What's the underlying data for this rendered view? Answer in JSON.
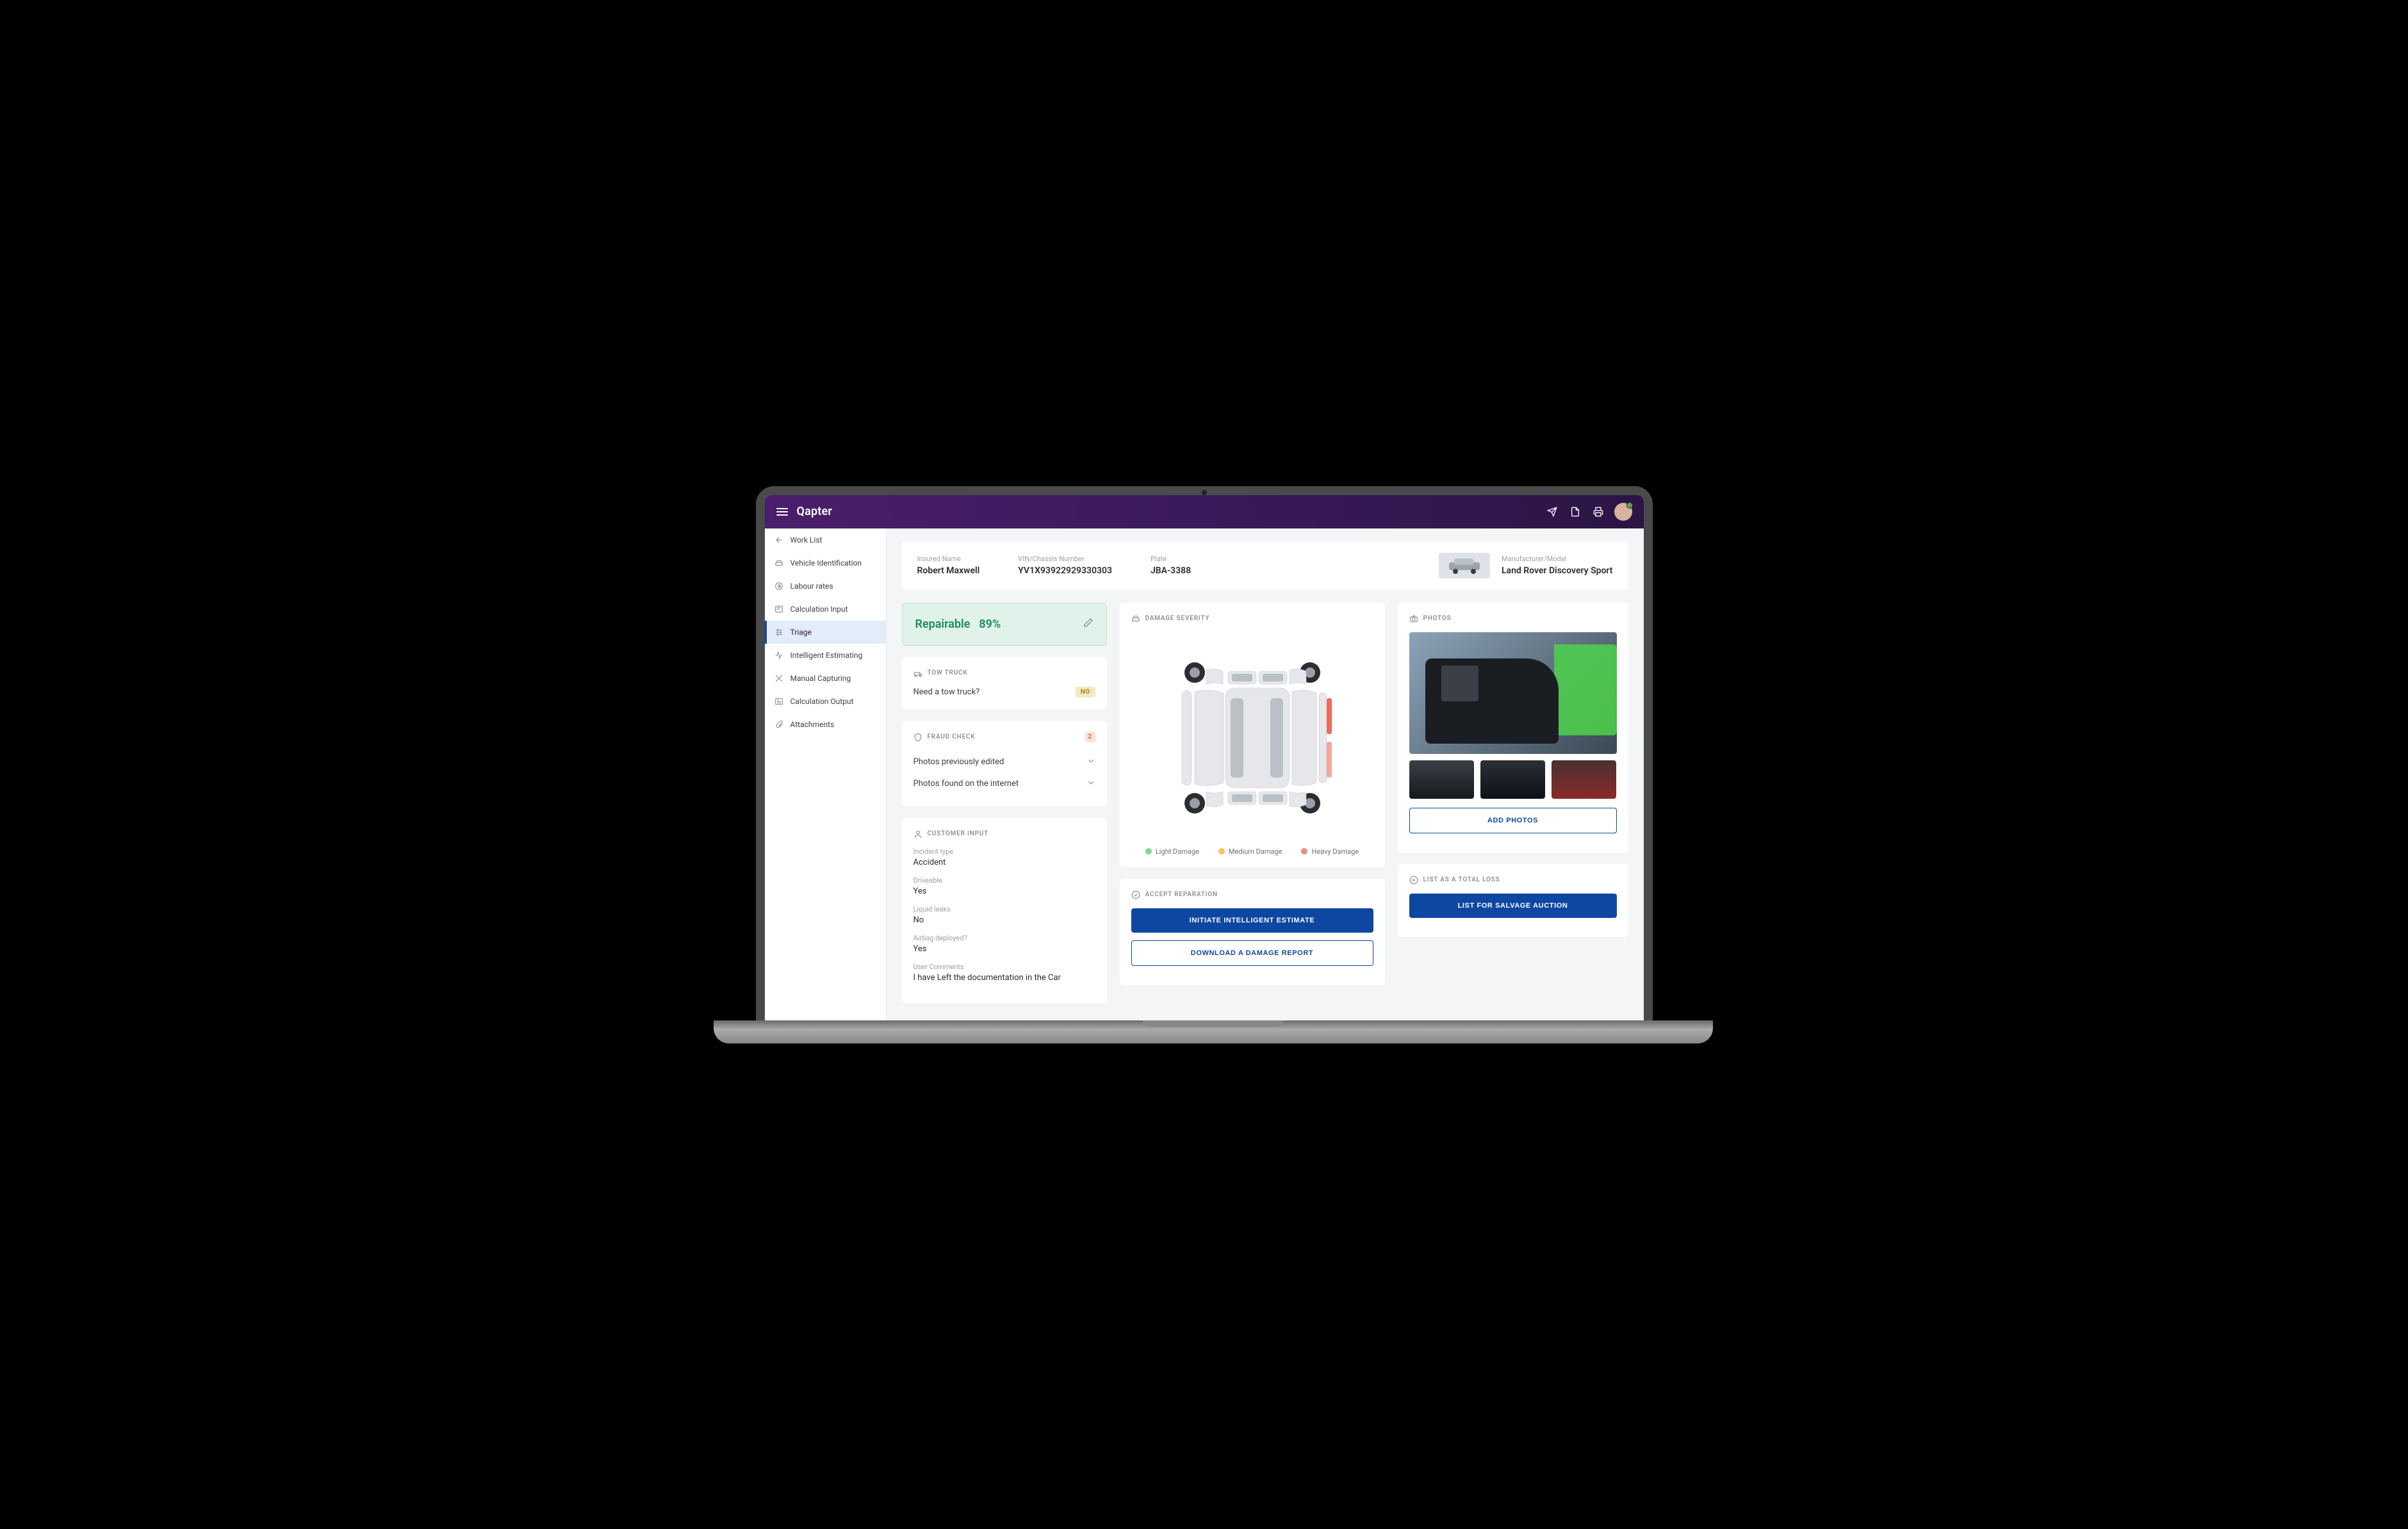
{
  "brand": "Qapter",
  "sidebar": {
    "backLabel": "Work List",
    "items": [
      {
        "label": "Vehicle Identification"
      },
      {
        "label": "Labour rates"
      },
      {
        "label": "Calculation Input"
      },
      {
        "label": "Triage"
      },
      {
        "label": "Intelligent Estimating"
      },
      {
        "label": "Manual Capturing"
      },
      {
        "label": "Calculation Output"
      },
      {
        "label": "Attachments"
      }
    ]
  },
  "header": {
    "insuredLabel": "Insured Name",
    "insuredValue": "Robert Maxwell",
    "vinLabel": "VIN/Chassis Number",
    "vinValue": "YV1X93922929330303",
    "plateLabel": "Plate",
    "plateValue": "JBA-3388",
    "modelLabel": "Manufacturer/Model",
    "modelValue": "Land Rover Discovery Sport"
  },
  "status": {
    "label": "Repairable",
    "pct": "89%"
  },
  "tow": {
    "header": "TOW TRUCK",
    "question": "Need a tow truck?",
    "pill": "NO"
  },
  "fraud": {
    "header": "FRAUD CHECK",
    "badge": "2",
    "rows": [
      "Photos previously edited",
      "Photos found on the internet"
    ]
  },
  "customer": {
    "header": "CUSTOMER INPUT",
    "fields": [
      {
        "label": "Incident type",
        "value": "Accident"
      },
      {
        "label": "Driveable",
        "value": "Yes"
      },
      {
        "label": "Liquid leaks",
        "value": "No"
      },
      {
        "label": "Airbag deployed?",
        "value": "Yes"
      },
      {
        "label": "User Comments",
        "value": "I have Left the documentation in the Car"
      }
    ]
  },
  "damage": {
    "header": "DAMAGE SEVERITY",
    "legend": {
      "light": "Light Damage",
      "medium": "Medium Damage",
      "heavy": "Heavy Damage"
    },
    "colors": {
      "light": "#7fdc8a",
      "medium": "#f6c85f",
      "heavy": "#f08a8a"
    }
  },
  "accept": {
    "header": "ACCEPT REPARATION",
    "primary": "INITIATE INTELLIGENT ESTIMATE",
    "secondary": "DOWNLOAD A DAMAGE REPORT"
  },
  "photos": {
    "header": "PHOTOS",
    "addBtn": "ADD PHOTOS"
  },
  "totalLoss": {
    "header": "LIST AS A TOTAL LOSS",
    "btn": "LIST FOR SALVAGE AUCTION"
  }
}
